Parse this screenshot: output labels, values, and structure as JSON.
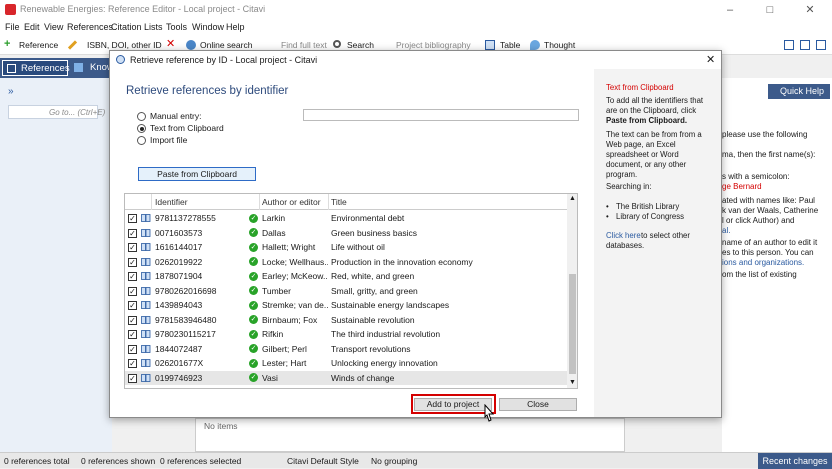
{
  "window": {
    "title": "Renewable Energies: Reference Editor - Local project - Citavi"
  },
  "menu": [
    "File",
    "Edit",
    "View",
    "References",
    "Citation",
    "Lists",
    "Tools",
    "Window",
    "Help"
  ],
  "toolbar": {
    "reference": "Reference",
    "isbn": "ISBN, DOI, other ID",
    "online_search": "Online search",
    "find_full_text": "Find full text",
    "search": "Search",
    "project_bibliography": "Project bibliography",
    "table": "Table",
    "thought": "Thought"
  },
  "nav": {
    "references": "References",
    "knowledge": "Know"
  },
  "left_panel": {
    "goto_placeholder": "Go to... (Ctrl+E)"
  },
  "quick_help": "Quick Help",
  "right_panel_lines": [
    "please use the following",
    "ma, then the first name(s):",
    "s with a semicolon:",
    "ge Bernard",
    "ated with names like: Paul",
    "k van der Waals, Catherine",
    "l or click Author) and",
    "al.",
    "name of an author to edit it",
    "es to this person. You can",
    "ions and organizations.",
    "om the list of existing"
  ],
  "dialog": {
    "title": "Retrieve reference by ID - Local project - Citavi",
    "heading": "Retrieve references by identifier",
    "options": [
      "Manual entry:",
      "Text from Clipboard",
      "Import file"
    ],
    "selected_option": "Text from Clipboard",
    "manual_value": "",
    "paste_button": "Paste from Clipboard",
    "columns": [
      "Identifier",
      "Author or editor",
      "Title"
    ],
    "rows": [
      {
        "id": "9781137278555",
        "author": "Larkin",
        "title": "Environmental debt"
      },
      {
        "id": "0071603573",
        "author": "Dallas",
        "title": "Green business basics"
      },
      {
        "id": "1616144017",
        "author": "Hallett; Wright",
        "title": "Life without oil"
      },
      {
        "id": "0262019922",
        "author": "Locke; Wellhaus...",
        "title": "Production in the innovation economy"
      },
      {
        "id": "1878071904",
        "author": "Earley; McKeow...",
        "title": "Red, white, and green"
      },
      {
        "id": "9780262016698",
        "author": "Tumber",
        "title": "Small, gritty, and green"
      },
      {
        "id": "1439894043",
        "author": "Stremke; van de...",
        "title": "Sustainable energy landscapes"
      },
      {
        "id": "9781583946480",
        "author": "Birnbaum; Fox",
        "title": "Sustainable revolution"
      },
      {
        "id": "9780230115217",
        "author": "Rifkin",
        "title": "The third industrial revolution"
      },
      {
        "id": "1844072487",
        "author": "Gilbert; Perl",
        "title": "Transport revolutions"
      },
      {
        "id": "026201677X",
        "author": "Lester; Hart",
        "title": "Unlocking energy innovation"
      },
      {
        "id": "0199746923",
        "author": "Vasi",
        "title": "Winds of change"
      }
    ],
    "add_button": "Add to project",
    "close_button": "Close",
    "side": {
      "heading": "Text from Clipboard",
      "para1": [
        "To add all the identifiers that",
        "are on the Clipboard, click",
        "Paste from Clipboard."
      ],
      "para2": [
        "The text can be from from a",
        "Web page, an Excel",
        "spreadsheet or Word",
        "document, or any other",
        "program."
      ],
      "searching": "Searching in:",
      "sources": [
        "The British Library",
        "Library of Congress"
      ],
      "click_here": "Click here",
      "click_rest": " to select other",
      "click_rest2": "databases."
    }
  },
  "middle_panel": {
    "no_items": "No items"
  },
  "status": {
    "total": "0 references total",
    "shown": "0 references shown",
    "selected": "0 references selected",
    "style": "Citavi Default Style",
    "grouping": "No grouping",
    "recent": "Recent changes"
  },
  "colors": {
    "accent": "#3c5a8a",
    "heading": "#2d4a7c",
    "red": "#d40000",
    "ok": "#29a329"
  }
}
